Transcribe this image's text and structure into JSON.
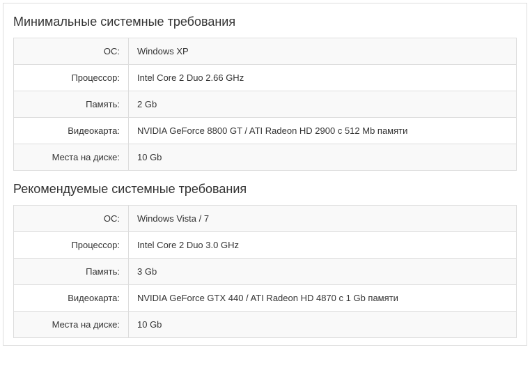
{
  "minimum": {
    "title": "Минимальные системные требования",
    "rows": [
      {
        "label": "ОС:",
        "value": "Windows XP"
      },
      {
        "label": "Процессор:",
        "value": "Intel Core 2 Duo 2.66 GHz"
      },
      {
        "label": "Память:",
        "value": "2 Gb"
      },
      {
        "label": "Видеокарта:",
        "value": "NVIDIA GeForce 8800 GT / ATI Radeon HD 2900 с 512 Mb памяти"
      },
      {
        "label": "Места на диске:",
        "value": "10 Gb"
      }
    ]
  },
  "recommended": {
    "title": "Рекомендуемые системные требования",
    "rows": [
      {
        "label": "ОС:",
        "value": "Windows Vista / 7"
      },
      {
        "label": "Процессор:",
        "value": "Intel Core 2 Duo 3.0 GHz"
      },
      {
        "label": "Память:",
        "value": "3 Gb"
      },
      {
        "label": "Видеокарта:",
        "value": "NVIDIA GeForce GTX 440 / ATI Radeon HD 4870 с 1 Gb памяти"
      },
      {
        "label": "Места на диске:",
        "value": "10 Gb"
      }
    ]
  }
}
